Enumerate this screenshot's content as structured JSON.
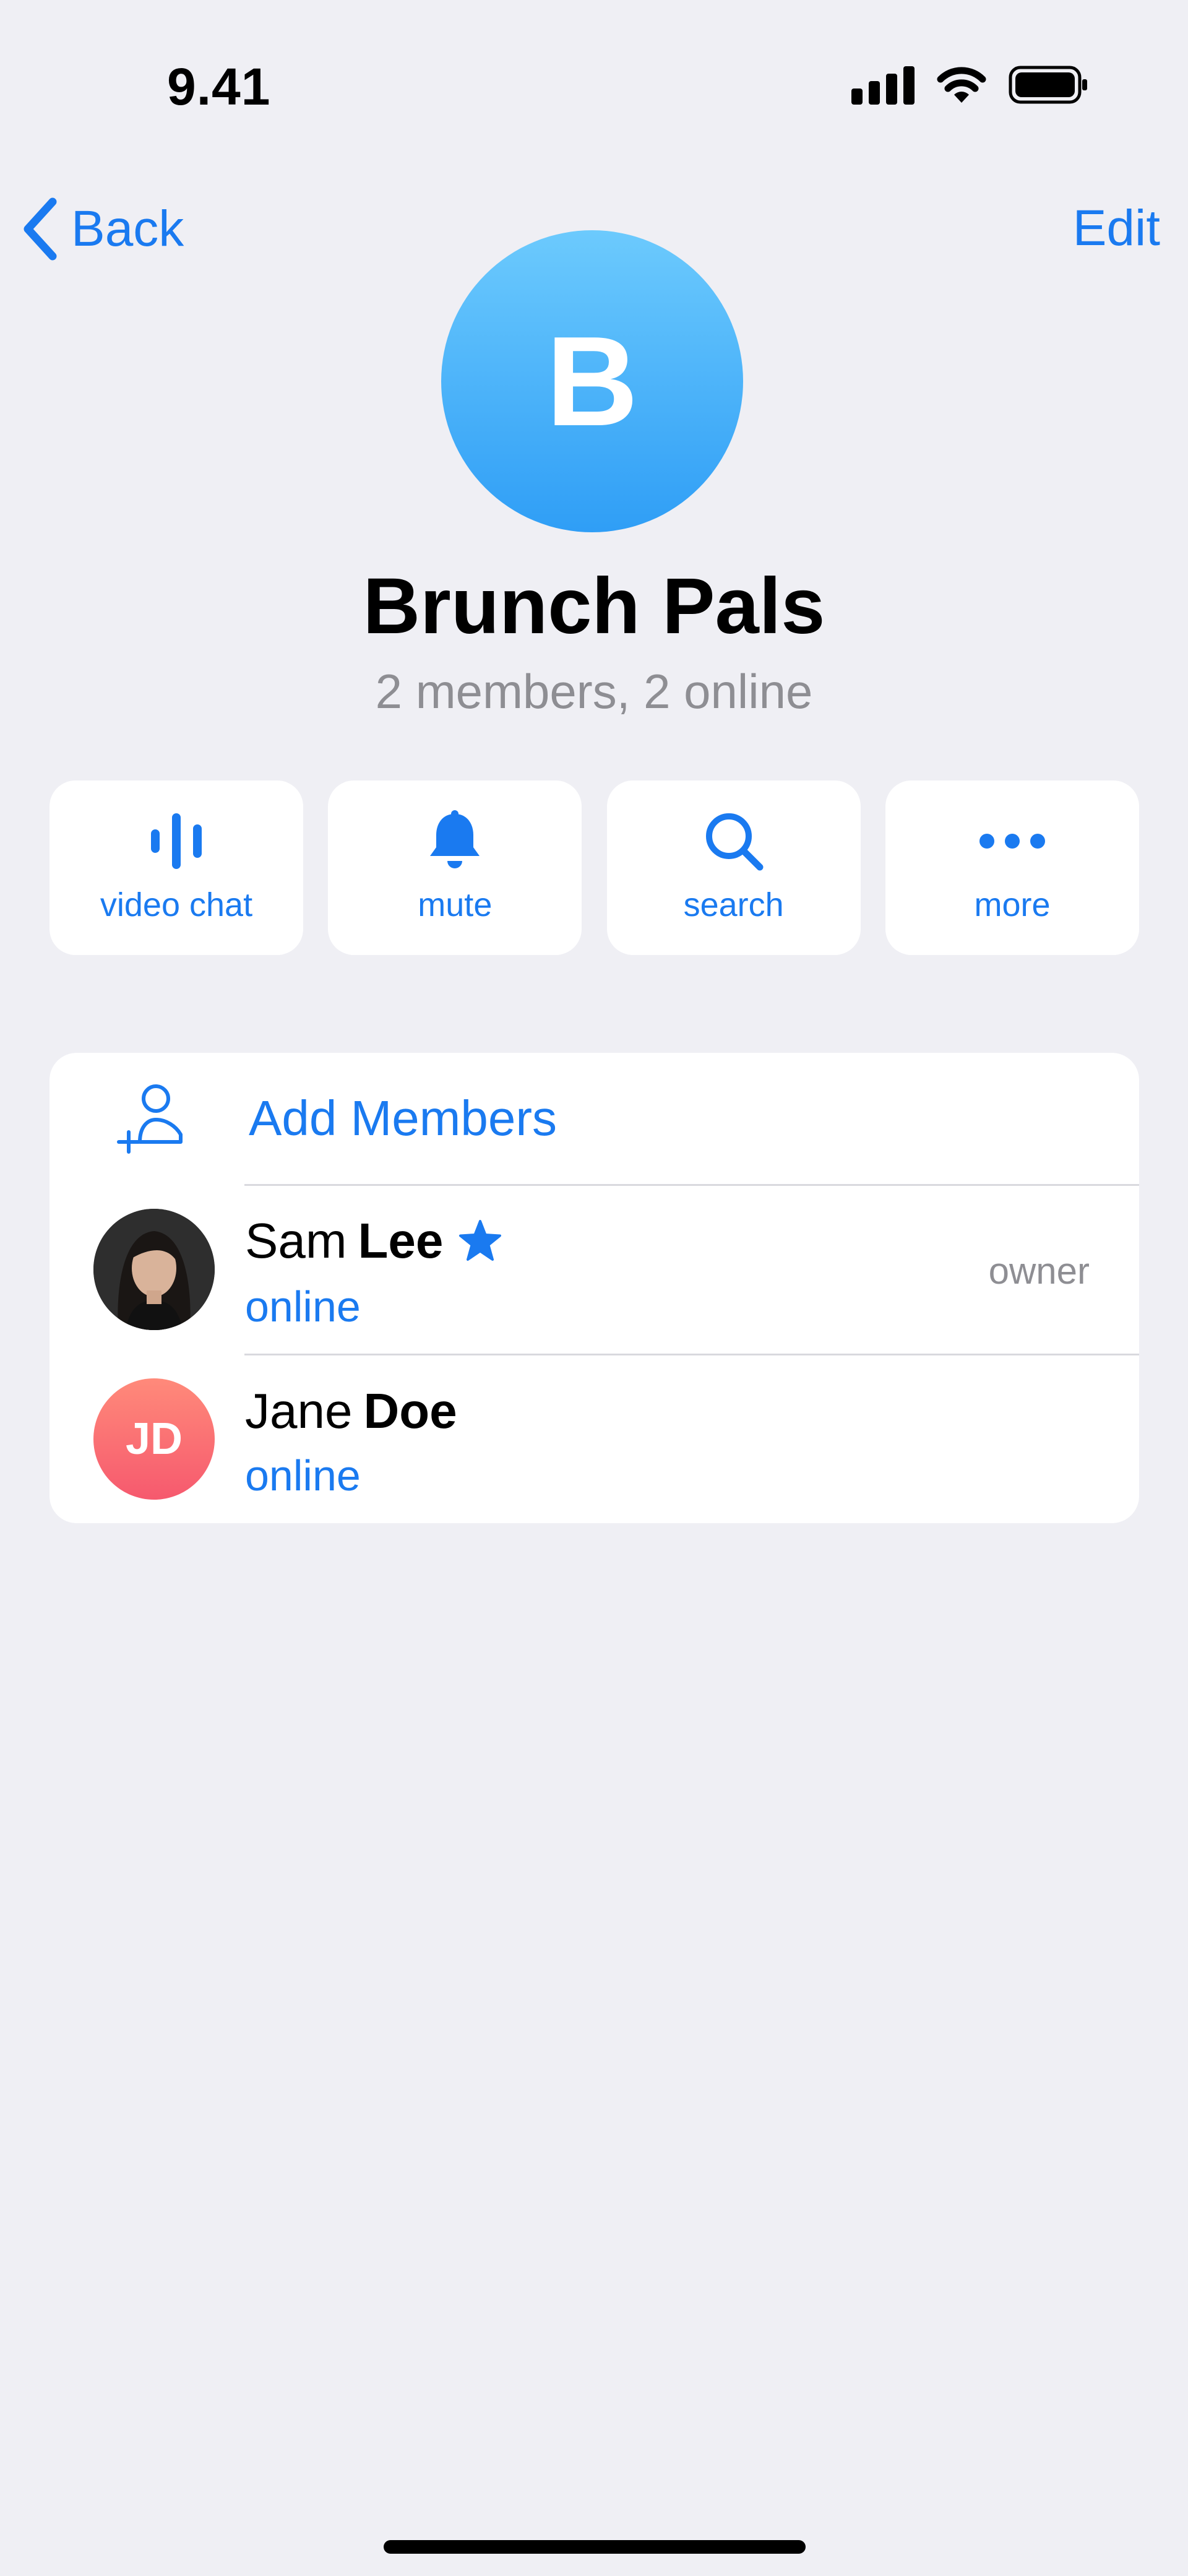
{
  "status_bar": {
    "time": "9.41"
  },
  "nav": {
    "back_label": "Back",
    "edit_label": "Edit"
  },
  "group": {
    "avatar_letter": "B",
    "name": "Brunch Pals",
    "subtitle": "2 members, 2 online"
  },
  "actions": [
    {
      "label": "video chat",
      "icon": "voice-bars-icon"
    },
    {
      "label": "mute",
      "icon": "bell-icon"
    },
    {
      "label": "search",
      "icon": "search-icon"
    },
    {
      "label": "more",
      "icon": "more-dots-icon"
    }
  ],
  "members_card": {
    "add_label": "Add Members",
    "members": [
      {
        "first": "Sam",
        "last": "Lee",
        "status": "online",
        "role": "owner",
        "badge": "star-icon"
      },
      {
        "first": "Jane",
        "last": "Doe",
        "status": "online",
        "initials": "JD"
      }
    ]
  },
  "colors": {
    "accent": "#1a7af0",
    "background": "#efeff4",
    "secondary_text": "#8e8e93"
  }
}
